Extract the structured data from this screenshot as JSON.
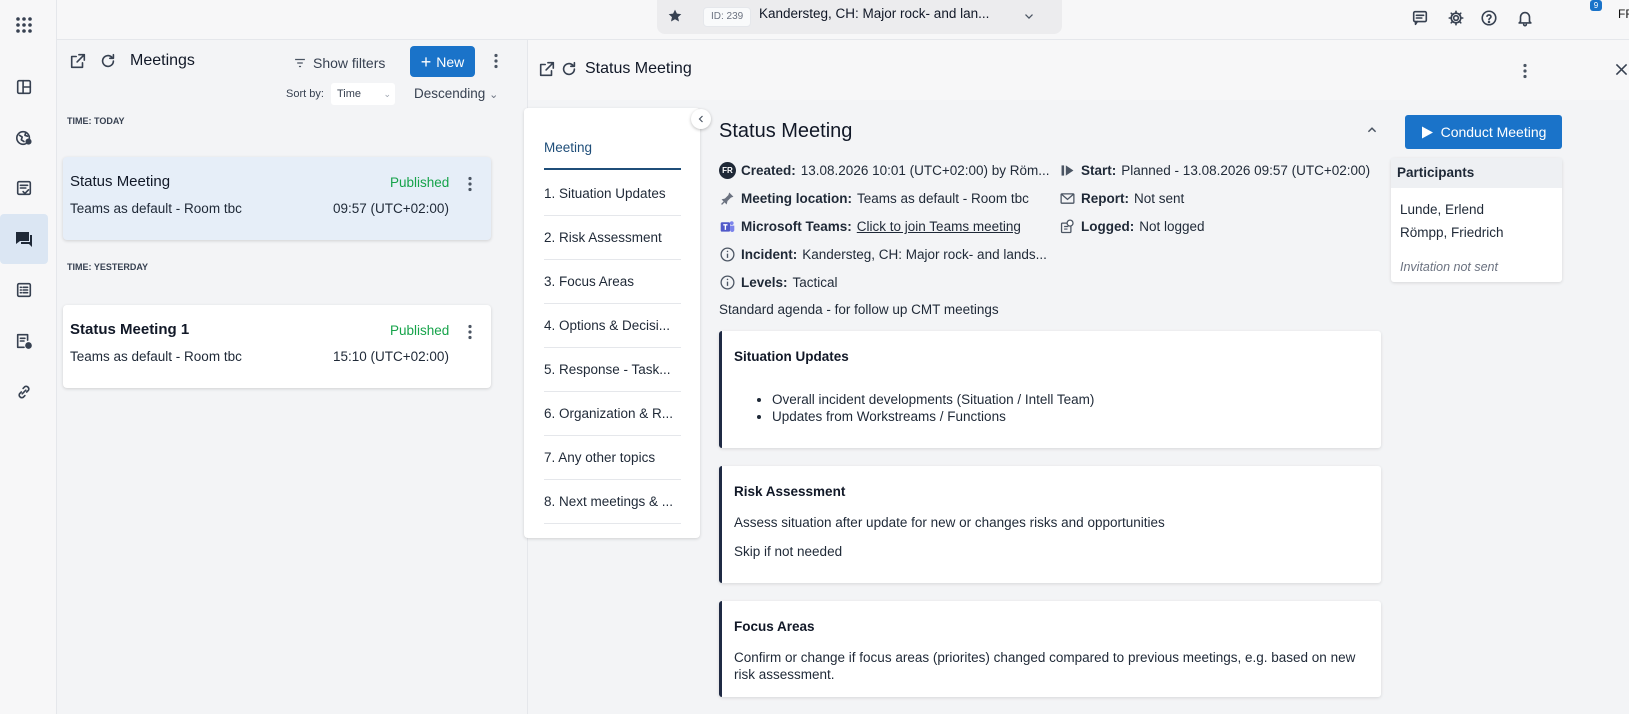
{
  "rail": {
    "items": [
      {
        "icon": "apps-grid-icon"
      },
      {
        "icon": "dashboard-icon"
      },
      {
        "icon": "globe-pin-icon"
      },
      {
        "icon": "checklist-icon"
      },
      {
        "icon": "chat-icon"
      },
      {
        "icon": "list-icon"
      },
      {
        "icon": "report-settings-icon"
      },
      {
        "icon": "link-icon"
      }
    ],
    "active": "chat-icon"
  },
  "topbar": {
    "incident_id": "ID: 239",
    "incident_title": "Kandersteg, CH: Major rock- and lan...",
    "notification_count": "9",
    "user_initials": "FR",
    "accent": "#1a73c9"
  },
  "list": {
    "title": "Meetings",
    "show_filters": "Show filters",
    "new_label": "New",
    "sort_by_label": "Sort by:",
    "sort_field": "Time",
    "sort_direction": "Descending",
    "groups": [
      {
        "header": "TIME: TODAY",
        "meetings": [
          {
            "title": "Status Meeting",
            "status": "Published",
            "location": "Teams as default - Room tbc",
            "time": "09:57 (UTC+02:00)"
          }
        ]
      },
      {
        "header": "TIME: YESTERDAY",
        "meetings": [
          {
            "title": "Status Meeting 1",
            "status": "Published",
            "location": "Teams as default - Room tbc",
            "time": "15:10 (UTC+02:00)"
          }
        ]
      }
    ]
  },
  "detail": {
    "header_title": "Status Meeting",
    "toc": [
      "Meeting",
      "1. Situation Updates",
      "2. Risk Assessment",
      "3. Focus Areas",
      "4. Options & Decisi...",
      "5. Response - Task...",
      "6. Organization & R...",
      "7. Any other topics",
      "8. Next meetings & ..."
    ],
    "title": "Status Meeting",
    "created_label": "Created:",
    "created_value": "13.08.2026 10:01 (UTC+02:00) by Röm...",
    "creator_initials": "FR",
    "location_label": "Meeting location:",
    "location_value": "Teams as default - Room tbc",
    "teams_label": "Microsoft Teams:",
    "teams_link": "Click to join Teams meeting",
    "incident_label": "Incident:",
    "incident_value": "Kandersteg, CH: Major rock- and lands...",
    "levels_label": "Levels:",
    "levels_value": "Tactical",
    "start_label": "Start:",
    "start_value": "Planned - 13.08.2026 09:57 (UTC+02:00)",
    "report_label": "Report:",
    "report_value": "Not sent",
    "logged_label": "Logged:",
    "logged_value": "Not logged",
    "agenda_description": "Standard agenda - for follow up CMT meetings",
    "agenda": [
      {
        "title": "Situation Updates",
        "bullets": [
          "Overall incident developments (Situation / Intell Team)",
          "Updates from Workstreams / Functions"
        ]
      },
      {
        "title": "Risk Assessment",
        "lines": [
          "Assess situation after update for new or changes risks and opportunities",
          "Skip if not needed"
        ]
      },
      {
        "title": "Focus Areas",
        "lines": [
          "Confirm or  change if focus areas (priorites) changed compared to previous meetings, e.g. based on new risk assessment."
        ]
      }
    ],
    "conduct_label": "Conduct Meeting",
    "participants_title": "Participants",
    "participants": [
      "Lunde, Erlend",
      "Römpp, Friedrich"
    ],
    "invitation_note": "Invitation not sent"
  }
}
